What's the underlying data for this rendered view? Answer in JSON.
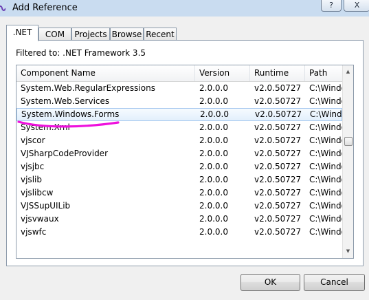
{
  "window": {
    "title": "Add Reference",
    "help_label": "?",
    "close_label": "X"
  },
  "tabs": [
    {
      "label": ".NET",
      "active": true
    },
    {
      "label": "COM",
      "active": false
    },
    {
      "label": "Projects",
      "active": false
    },
    {
      "label": "Browse",
      "active": false
    },
    {
      "label": "Recent",
      "active": false
    }
  ],
  "filter_text": "Filtered to: .NET Framework 3.5",
  "table": {
    "columns": [
      "Component Name",
      "Version",
      "Runtime",
      "Path"
    ],
    "rows": [
      [
        "System.Web.RegularExpressions",
        "2.0.0.0",
        "v2.0.50727",
        "C:\\Windo"
      ],
      [
        "System.Web.Services",
        "2.0.0.0",
        "v2.0.50727",
        "C:\\Windo"
      ],
      [
        "System.Windows.Forms",
        "2.0.0.0",
        "v2.0.50727",
        "C:\\Windo"
      ],
      [
        "System.Xml",
        "2.0.0.0",
        "v2.0.50727",
        "C:\\Windo"
      ],
      [
        "vjscor",
        "2.0.0.0",
        "v2.0.50727",
        "C:\\Windo"
      ],
      [
        "VJSharpCodeProvider",
        "2.0.0.0",
        "v2.0.50727",
        "C:\\Windo"
      ],
      [
        "vjsjbc",
        "2.0.0.0",
        "v2.0.50727",
        "C:\\Windo"
      ],
      [
        "vjslib",
        "2.0.0.0",
        "v2.0.50727",
        "C:\\Windo"
      ],
      [
        "vjslibcw",
        "2.0.0.0",
        "v2.0.50727",
        "C:\\Windo"
      ],
      [
        "VJSSupUILib",
        "2.0.0.0",
        "v2.0.50727",
        "C:\\Windo"
      ],
      [
        "vjsvwaux",
        "2.0.0.0",
        "v2.0.50727",
        "C:\\Windo"
      ],
      [
        "vjswfc",
        "2.0.0.0",
        "v2.0.50727",
        "C:\\Windo"
      ]
    ],
    "selected_row": "System.Windows.Forms"
  },
  "buttons": {
    "ok": "OK",
    "cancel": "Cancel"
  },
  "colors": {
    "annotation": "#ee11dd",
    "selection_border": "#a6c8ef",
    "titlebar": "#c9dcf0"
  }
}
